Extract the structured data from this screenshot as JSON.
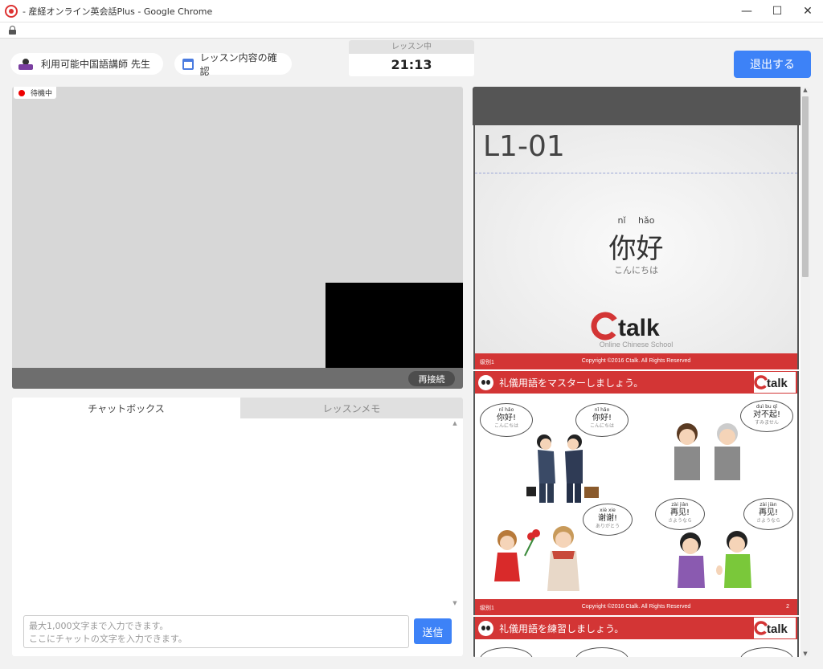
{
  "window": {
    "title": "- 産経オンライン英会話Plus - Google Chrome",
    "minimize": "—",
    "maximize": "☐",
    "close": "✕"
  },
  "header": {
    "teacher_label": "利用可能中国語講師 先生",
    "lesson_content_label": "レッスン内容の確認",
    "timer_label": "レッスン中",
    "timer_value": "21:13",
    "exit_label": "退出する"
  },
  "video": {
    "status_label": "待機中",
    "reconnect_label": "再接続"
  },
  "chat": {
    "tabs": [
      {
        "label": "チャットボックス",
        "active": true
      },
      {
        "label": "レッスンメモ",
        "active": false
      }
    ],
    "input_placeholder_line1": "最大1,000文字まで入力できます。",
    "input_placeholder_line2": "ここにチャットの文字を入力できます。",
    "send_label": "送信"
  },
  "slides": {
    "slide1": {
      "lesson_code": "L1-01",
      "pinyin": "nǐ hǎo",
      "hanzi": "你好",
      "kana": "こんにちは",
      "logo_text": "talk",
      "logo_sub": "Online Chinese School",
      "footer_left": "级别1",
      "footer_center": "Copyright ©2016 Ctalk. All Rights Reserved"
    },
    "slide2": {
      "title": "礼儀用語をマスターしましょう。",
      "bubbles": [
        {
          "pinyin": "nǐ hǎo",
          "hanzi": "你好!",
          "kana": "こんにちは"
        },
        {
          "pinyin": "nǐ hǎo",
          "hanzi": "你好!",
          "kana": "こんにちは"
        },
        {
          "pinyin": "duì bu qǐ",
          "hanzi": "对不起!",
          "kana": "すみません"
        },
        {
          "pinyin": "xiè xie",
          "hanzi": "谢谢!",
          "kana": "ありがとう"
        },
        {
          "pinyin": "zài jiàn",
          "hanzi": "再见!",
          "kana": "さようなら"
        },
        {
          "pinyin": "zài jiàn",
          "hanzi": "再见!",
          "kana": "さようなら"
        }
      ],
      "footer_left": "级别1",
      "footer_center": "Copyright ©2016 Ctalk. All Rights Reserved",
      "footer_right": "2"
    },
    "slide3": {
      "title": "礼儀用語を練習しましょう。"
    },
    "mini_logo_text": "talk"
  },
  "colors": {
    "accent_blue": "#3d82f7",
    "slide_red": "#d33535",
    "status_red": "#e00000"
  }
}
